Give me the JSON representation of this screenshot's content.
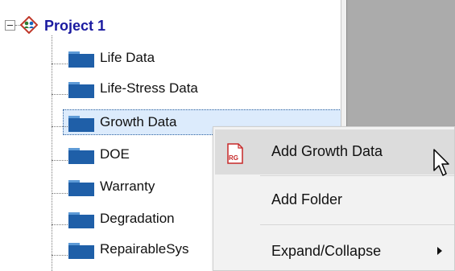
{
  "tree": {
    "project": {
      "label": "Project 1"
    },
    "items": [
      {
        "label": "Life Data"
      },
      {
        "label": "Life-Stress Data"
      },
      {
        "label": "Growth Data"
      },
      {
        "label": "DOE"
      },
      {
        "label": "Warranty"
      },
      {
        "label": "Degradation"
      },
      {
        "label": "RepairableSys"
      }
    ]
  },
  "context_menu": {
    "add_growth_data": "Add Growth Data",
    "add_growth_icon_text": "RG",
    "add_folder": "Add Folder",
    "expand_collapse": "Expand/Collapse"
  },
  "colors": {
    "folder": "#1f5fa8",
    "project_label": "#1a1aa0",
    "selection": "#dcebfc",
    "menu_background": "#f2f2f2",
    "right_panel": "#ababab"
  }
}
